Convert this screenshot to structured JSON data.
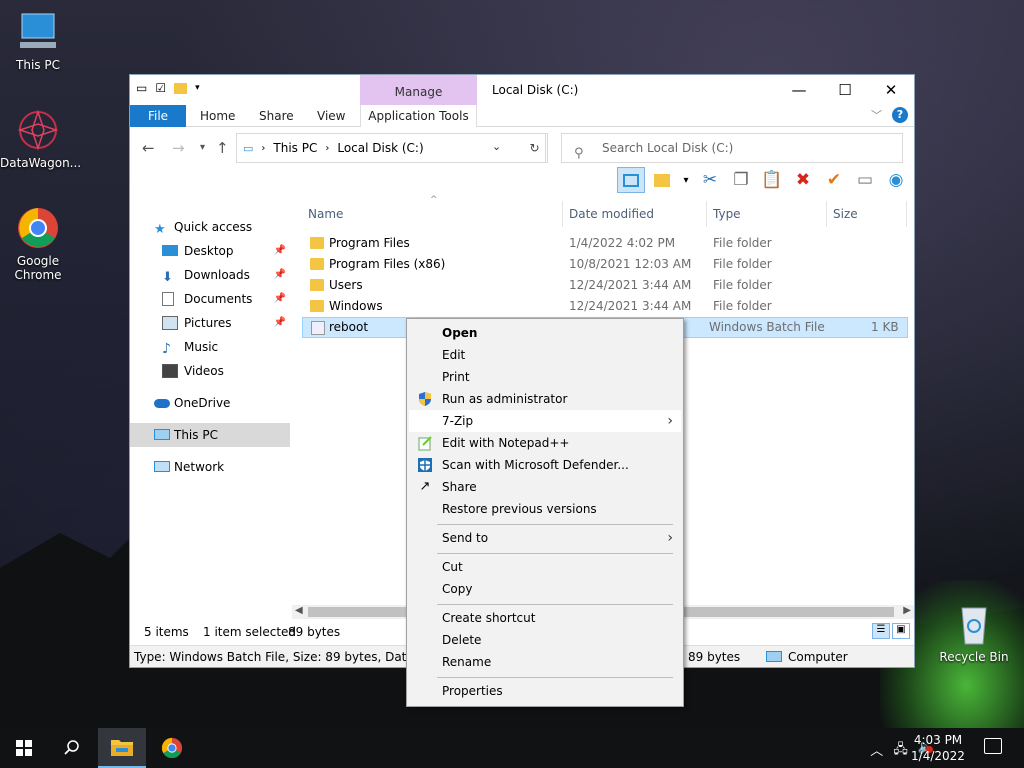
{
  "desktop": {
    "icons": [
      {
        "label": "This PC"
      },
      {
        "label": "DataWagon..."
      },
      {
        "label": "Google Chrome"
      },
      {
        "label": "Recycle Bin"
      }
    ]
  },
  "window": {
    "title": "Local Disk (C:)",
    "manage_label": "Manage",
    "tabs": {
      "file": "File",
      "home": "Home",
      "share": "Share",
      "view": "View",
      "app_tools": "Application Tools"
    },
    "help": "?",
    "address": {
      "segments": [
        "This PC",
        "Local Disk (C:)"
      ]
    },
    "search": {
      "placeholder": "Search Local Disk (C:)"
    },
    "nav": {
      "quick_access": "Quick access",
      "desktop": "Desktop",
      "downloads": "Downloads",
      "documents": "Documents",
      "pictures": "Pictures",
      "music": "Music",
      "videos": "Videos",
      "onedrive": "OneDrive",
      "this_pc": "This PC",
      "network": "Network"
    },
    "columns": {
      "name": "Name",
      "date": "Date modified",
      "type": "Type",
      "size": "Size"
    },
    "files": [
      {
        "name": "Program Files",
        "date": "1/4/2022 4:02 PM",
        "type": "File folder",
        "size": ""
      },
      {
        "name": "Program Files (x86)",
        "date": "10/8/2021 12:03 AM",
        "type": "File folder",
        "size": ""
      },
      {
        "name": "Users",
        "date": "12/24/2021 3:44 AM",
        "type": "File folder",
        "size": ""
      },
      {
        "name": "Windows",
        "date": "12/24/2021 3:44 AM",
        "type": "File folder",
        "size": ""
      },
      {
        "name": "reboot",
        "date": "",
        "type": "Windows Batch File",
        "size": "1 KB"
      }
    ],
    "status": {
      "items": "5 items",
      "selected": "1 item selected",
      "size": "89 bytes"
    },
    "details": {
      "text": "Type: Windows Batch File, Size: 89 bytes, Date modif",
      "size": "89 bytes",
      "location": "Computer"
    }
  },
  "context_menu": {
    "open": "Open",
    "edit": "Edit",
    "print": "Print",
    "run_admin": "Run as administrator",
    "zip": "7-Zip",
    "notepad": "Edit with Notepad++",
    "defender": "Scan with Microsoft Defender...",
    "share": "Share",
    "restore": "Restore previous versions",
    "send_to": "Send to",
    "cut": "Cut",
    "copy": "Copy",
    "create_shortcut": "Create shortcut",
    "delete": "Delete",
    "rename": "Rename",
    "properties": "Properties"
  },
  "taskbar": {
    "time": "4:03 PM",
    "date": "1/4/2022"
  },
  "colors": {
    "accent": "#1979ca",
    "manage_tab": "#e3c4f0",
    "selection": "#cce8ff"
  }
}
